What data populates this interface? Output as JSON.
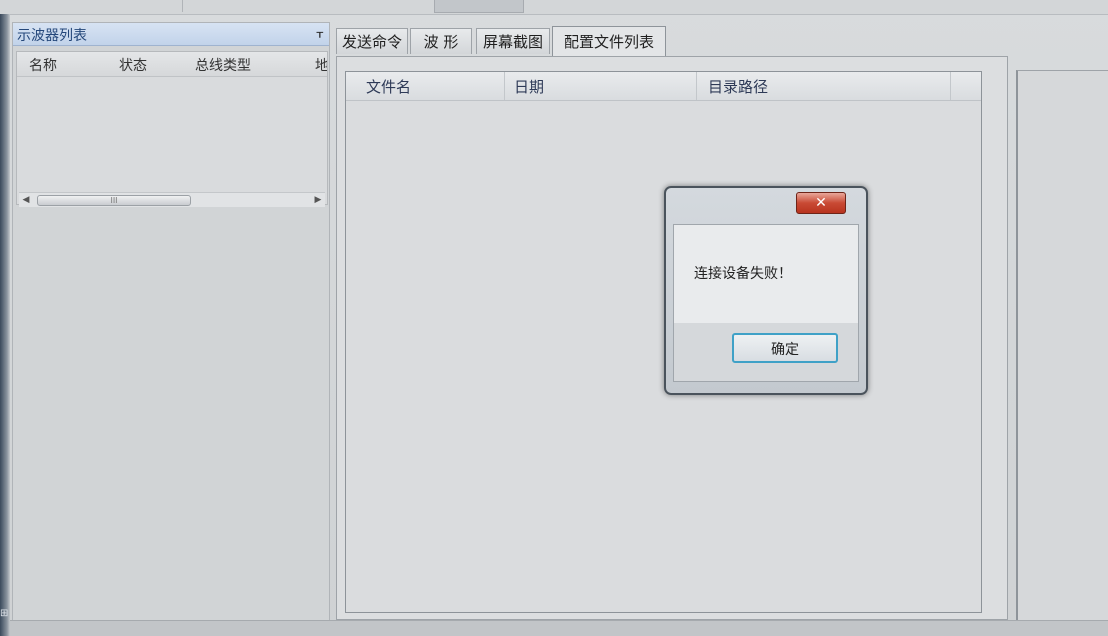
{
  "left_panel": {
    "title": "示波器列表",
    "columns": [
      "名称",
      "状态",
      "总线类型",
      "地"
    ],
    "scroll_thumb_grip": "III"
  },
  "tabs": [
    {
      "label": "发送命令",
      "active": false
    },
    {
      "label": "波 形",
      "active": false
    },
    {
      "label": "屏幕截图",
      "active": false
    },
    {
      "label": "配置文件列表",
      "active": true
    }
  ],
  "file_list": {
    "columns": [
      "文件名",
      "日期",
      "目录路径"
    ]
  },
  "dialog": {
    "message": "连接设备失败！",
    "ok_label": "确定"
  },
  "colors": {
    "panel_title_text": "#24477a",
    "close_button": "#c94a34",
    "ok_button_border": "#3fa1c7"
  }
}
